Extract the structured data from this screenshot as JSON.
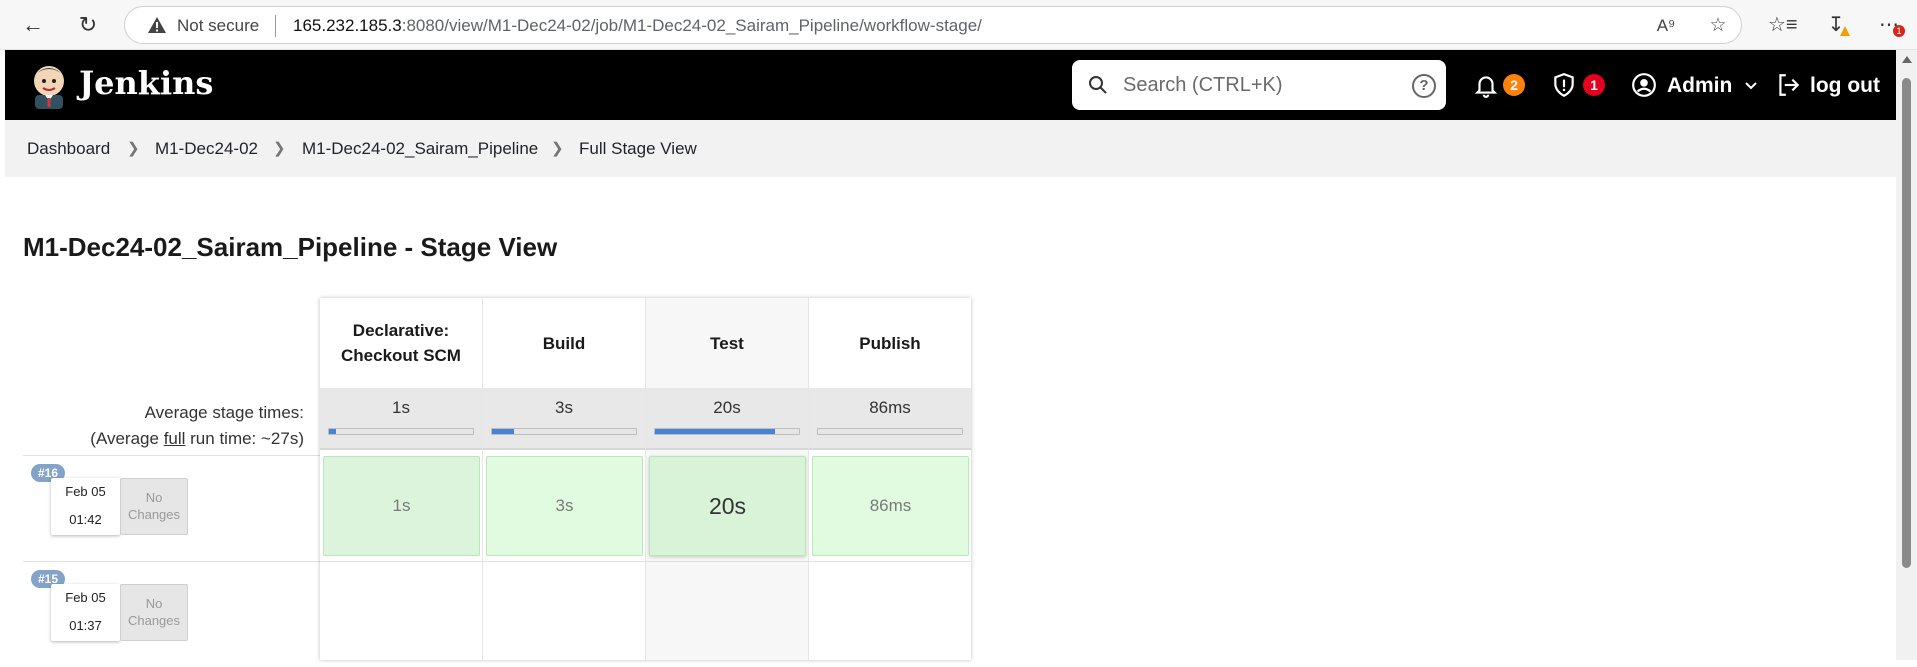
{
  "browser": {
    "not_secure": "Not secure",
    "url_host": "165.232.185.3",
    "url_path": ":8080/view/M1-Dec24-02/job/M1-Dec24-02_Sairam_Pipeline/workflow-stage/",
    "more_badge": "1"
  },
  "header": {
    "brand": "Jenkins",
    "search_placeholder": "Search (CTRL+K)",
    "notifications_count": "2",
    "security_count": "1",
    "user_name": "Admin",
    "logout_label": "log out"
  },
  "breadcrumb": [
    "Dashboard",
    "M1-Dec24-02",
    "M1-Dec24-02_Sairam_Pipeline",
    "Full Stage View"
  ],
  "page_title": "M1-Dec24-02_Sairam_Pipeline - Stage View",
  "avg_label": {
    "line1": "Average stage times:",
    "prefix": "(Average ",
    "full": "full",
    "suffix": " run time: ~27s)"
  },
  "stages": [
    {
      "name": "Declarative: Checkout SCM",
      "avg": "1s",
      "avg_fraction": 0.05
    },
    {
      "name": "Build",
      "avg": "3s",
      "avg_fraction": 0.15
    },
    {
      "name": "Test",
      "avg": "20s",
      "avg_fraction": 0.83
    },
    {
      "name": "Publish",
      "avg": "86ms",
      "avg_fraction": 0.0
    }
  ],
  "builds": [
    {
      "number": "#16",
      "date": "Feb 05",
      "time": "01:42",
      "changes": "No Changes",
      "durations": [
        "1s",
        "3s",
        "20s",
        "86ms"
      ]
    },
    {
      "number": "#15",
      "date": "Feb 05",
      "time": "01:37",
      "changes": "No Changes",
      "durations": [
        "",
        "",
        "",
        ""
      ]
    }
  ],
  "colors": {
    "header_bg": "#000000",
    "success_cell": "#e0f8e0",
    "progress_bar": "#4a83d6",
    "notification_badge": "#fe820a",
    "security_badge": "#e6001f",
    "build_badge": "#84a3c8"
  }
}
